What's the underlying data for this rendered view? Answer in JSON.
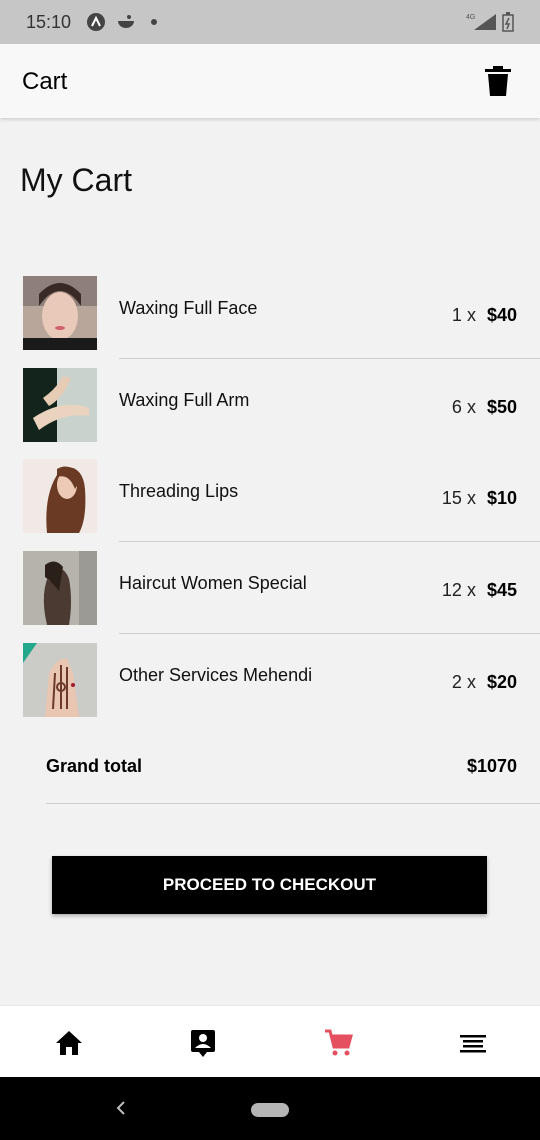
{
  "status_bar": {
    "time": "15:10"
  },
  "app_bar": {
    "title": "Cart"
  },
  "page": {
    "title": "My Cart"
  },
  "cart_items": [
    {
      "name": "Waxing Full Face",
      "qty": "1",
      "price": "$40"
    },
    {
      "name": "Waxing Full Arm",
      "qty": "6",
      "price": "$50"
    },
    {
      "name": "Threading Lips",
      "qty": "15",
      "price": "$10"
    },
    {
      "name": "Haircut Women Special",
      "qty": "12",
      "price": "$45"
    },
    {
      "name": "Other Services Mehendi",
      "qty": "2",
      "price": "$20"
    }
  ],
  "qty_separator": "x",
  "totals": {
    "label": "Grand total",
    "value": "$1070"
  },
  "checkout": {
    "label": "PROCEED TO CHECKOUT"
  },
  "bottom_nav": {
    "items": [
      {
        "icon": "home-icon"
      },
      {
        "icon": "contact-icon"
      },
      {
        "icon": "cart-icon",
        "active": true
      },
      {
        "icon": "menu-icon"
      }
    ],
    "active_color": "#e4505f"
  },
  "colors": {
    "accent": "#e4505f",
    "button": "#000000"
  }
}
